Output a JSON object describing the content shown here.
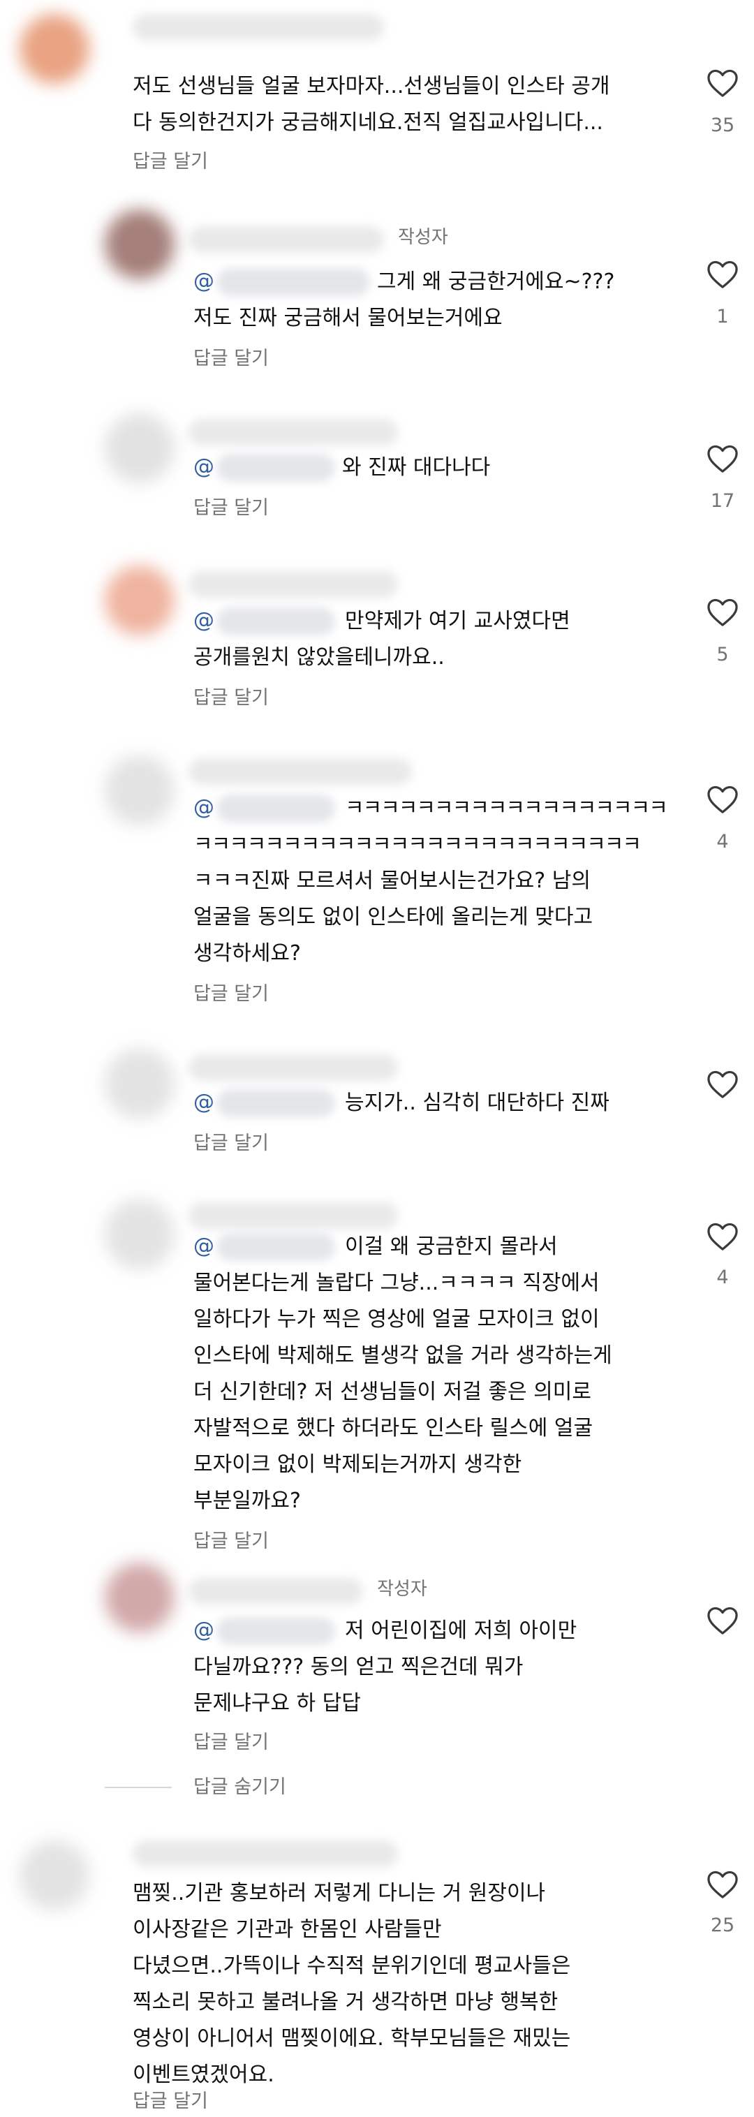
{
  "labels": {
    "reply": "답글 달기",
    "author": "작성자",
    "hide_replies": "답글 숨기기",
    "at": "@"
  },
  "comments": [
    {
      "lines": [
        "저도 선생님들 얼굴 보자마자...선생님들이 인스타 공개",
        "다 동의한건지가 궁금해지네요.전직 얼집교사입니다..."
      ],
      "likes": "35"
    },
    {
      "lines": [
        "그게 왜 궁금한거에요~???",
        "저도 진짜 궁금해서 물어보는거에요"
      ],
      "likes": "1"
    },
    {
      "lines": [
        "와 진짜 대다나다"
      ],
      "likes": "17"
    },
    {
      "lines": [
        "만약제가 여기 교사였다면",
        "공개를원치 않았을테니까요.."
      ],
      "likes": "5"
    },
    {
      "lines": [
        "ㅋㅋㅋㅋㅋㅋㅋㅋㅋㅋㅋㅋㅋㅋㅋㅋㅋㅋ",
        "ㅋㅋㅋㅋㅋㅋㅋㅋㅋㅋㅋㅋㅋㅋㅋㅋㅋㅋㅋㅋㅋㅋㅋㅋㅋ",
        "ㅋㅋㅋ진짜 모르셔서 물어보시는건가요? 남의",
        "얼굴을 동의도 없이 인스타에 올리는게 맞다고",
        "생각하세요?"
      ],
      "likes": "4"
    },
    {
      "lines": [
        "능지가.. 심각히 대단하다  진짜"
      ],
      "likes": ""
    },
    {
      "lines": [
        "이걸 왜 궁금한지 몰라서",
        "물어본다는게 놀랍다 그냥...ㅋㅋㅋㅋ  직장에서",
        "일하다가 누가 찍은 영상에 얼굴 모자이크 없이",
        "인스타에 박제해도 별생각 없을 거라 생각하는게",
        "더 신기한데? 저 선생님들이 저걸 좋은 의미로",
        "자발적으로 했다 하더라도 인스타 릴스에 얼굴",
        "모자이크 없이 박제되는거까지 생각한",
        "부분일까요?"
      ],
      "likes": "4"
    },
    {
      "lines": [
        "저 어린이집에 저희 아이만",
        "다닐까요??? 동의 얻고 찍은건데 뭐가",
        "문제냐구요 하 답답"
      ],
      "likes": ""
    },
    {
      "lines": [
        "맴찢..기관 홍보하러 저렇게 다니는 거 원장이나",
        "이사장같은 기관과 한몸인 사람들만",
        "다녔으면..가뜩이나 수직적 분위기인데 평교사들은",
        "찍소리 못하고 불려나올 거 생각하면 마냥 행복한",
        "영상이 아니어서 맴찢이에요. 학부모님들은 재밌는",
        "이벤트였겠어요."
      ],
      "likes": "25"
    }
  ],
  "colors": {
    "text": "#111111",
    "secondary": "#737373",
    "mention": "#2f5f9e",
    "background": "#ffffff"
  },
  "icons": {
    "like": "heart-outline-icon"
  }
}
